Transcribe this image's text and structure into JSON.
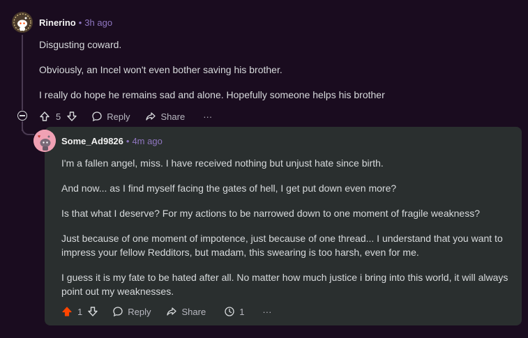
{
  "parent": {
    "username": "Rinerino",
    "separator": "•",
    "time": "3h ago",
    "paragraphs": [
      "Disgusting coward.",
      "Obviously, an Incel won't even bother saving his brother.",
      "I really do hope he remains sad and alone. Hopefully someone helps his brother"
    ],
    "score": "5",
    "reply_label": "Reply",
    "share_label": "Share",
    "more_label": "···"
  },
  "reply": {
    "username": "Some_Ad9826",
    "separator": "•",
    "time": "4m ago",
    "paragraphs": [
      "I'm a fallen angel, miss. I have received nothing but unjust hate since birth.",
      "And now... as I find myself facing the gates of hell, I get put down even more?",
      "Is that what I deserve? For my actions to be narrowed down to one moment of fragile weakness?",
      "Just because of one moment of impotence, just because of one thread... I understand that you want to impress your fellow Redditors, but madam, this swearing is too harsh, even for me.",
      "I guess it is my fate to be hated after all. No matter how much justice i bring into this world, it will always point out my weaknesses."
    ],
    "score": "1",
    "reply_label": "Reply",
    "share_label": "Share",
    "award_count": "1",
    "more_label": "···"
  },
  "colors": {
    "background": "#1a0c1f",
    "card": "#2a2f2f",
    "upvote_active": "#ff4500",
    "timestamp": "#8f76c0"
  }
}
